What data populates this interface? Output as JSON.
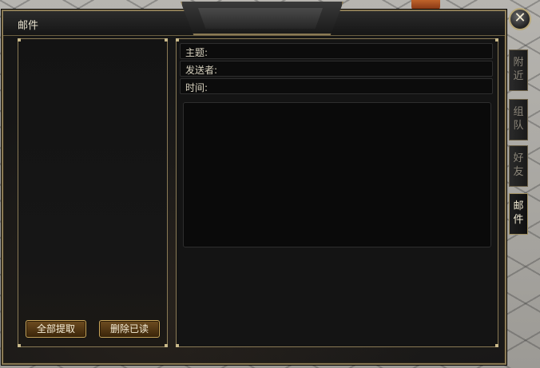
{
  "window": {
    "title": "邮件",
    "close_label": "✕"
  },
  "mail_detail": {
    "subject_label": "主题:",
    "sender_label": "发送者:",
    "time_label": "时间:"
  },
  "actions": {
    "collect_all_label": "全部提取",
    "delete_read_label": "删除已读"
  },
  "side_tabs": [
    {
      "label": "附近",
      "active": false
    },
    {
      "label": "组队",
      "active": false
    },
    {
      "label": "好友",
      "active": false
    },
    {
      "label": "邮件",
      "active": true
    }
  ],
  "colors": {
    "frame_gold": "#8a7a55",
    "button_brown": "#6e4d21",
    "text_light": "#e8e2cf"
  }
}
